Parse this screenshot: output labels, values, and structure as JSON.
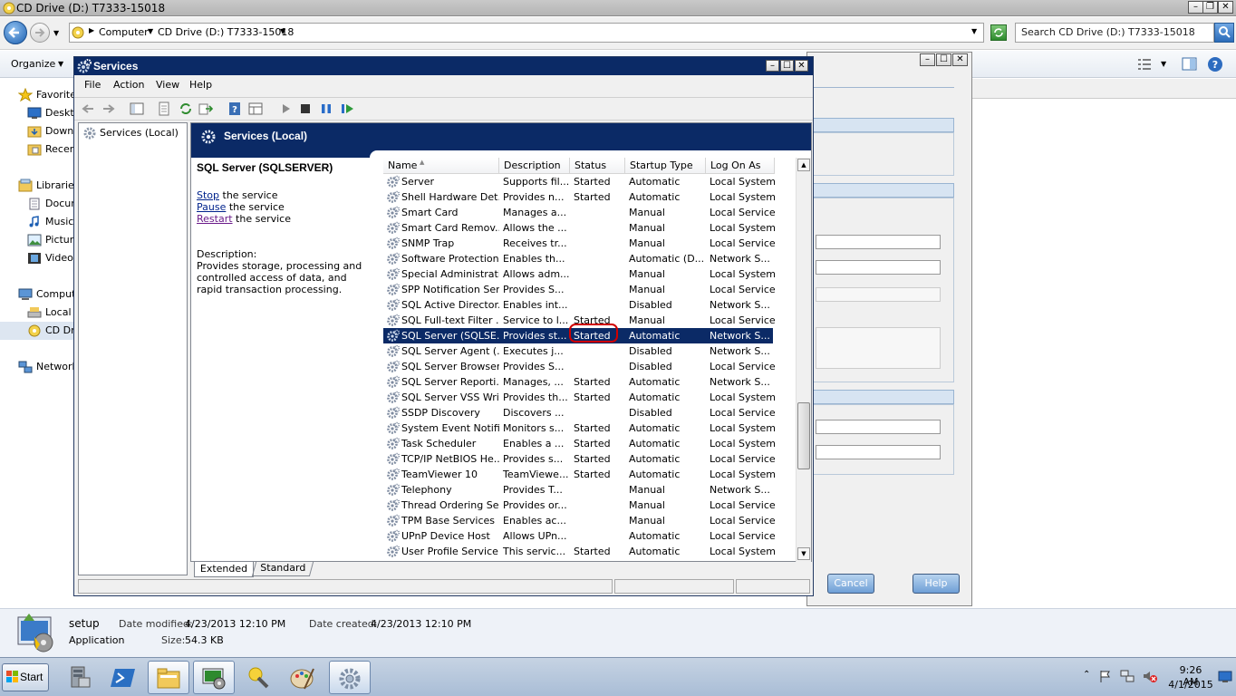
{
  "explorer": {
    "title": "CD Drive (D:) T7333-15018",
    "breadcrumb": [
      "Computer",
      "CD Drive (D:) T7333-15018"
    ],
    "search_placeholder": "Search CD Drive (D:) T7333-15018",
    "organize_label": "Organize",
    "nav_items": [
      {
        "label": "Favorites",
        "icon": "star-icon"
      },
      {
        "label": "Desktop",
        "icon": "desktop-icon"
      },
      {
        "label": "Downloads",
        "icon": "downloads-folder-icon"
      },
      {
        "label": "Recent Places",
        "icon": "recent-places-icon"
      },
      {
        "label": "Libraries",
        "icon": "library-icon"
      },
      {
        "label": "Documents",
        "icon": "documents-icon"
      },
      {
        "label": "Music",
        "icon": "music-icon"
      },
      {
        "label": "Pictures",
        "icon": "pictures-icon"
      },
      {
        "label": "Videos",
        "icon": "videos-icon"
      },
      {
        "label": "Computer",
        "icon": "computer-icon"
      },
      {
        "label": "Local Disk",
        "icon": "local-disk-icon"
      },
      {
        "label": "CD Drive",
        "icon": "cd-drive-icon"
      },
      {
        "label": "Network",
        "icon": "network-icon"
      }
    ],
    "details": {
      "name": "setup",
      "type": "Application",
      "date_modified_label": "Date modified:",
      "date_modified": "4/23/2013 12:10 PM",
      "date_created_label": "Date created:",
      "date_created": "4/23/2013 12:10 PM",
      "size_label": "Size:",
      "size": "54.3 KB"
    }
  },
  "dialog": {
    "cancel_label": "Cancel",
    "help_label": "Help"
  },
  "services_window": {
    "title": "Services",
    "menu": [
      "File",
      "Action",
      "View",
      "Help"
    ],
    "tree_item": "Services (Local)",
    "header_title": "Services (Local)",
    "selected_service": {
      "name": "SQL Server (SQLSERVER)",
      "actions": [
        {
          "link": "Stop",
          "rest": " the service"
        },
        {
          "link": "Pause",
          "rest": " the service"
        },
        {
          "link": "Restart",
          "rest": " the service"
        }
      ],
      "description_label": "Description:",
      "description": "Provides storage, processing and controlled access of data, and rapid transaction processing."
    },
    "columns": [
      "Name",
      "Description",
      "Status",
      "Startup Type",
      "Log On As"
    ],
    "rows": [
      {
        "name": "Server",
        "desc": "Supports fil...",
        "status": "Started",
        "startup": "Automatic",
        "logon": "Local System"
      },
      {
        "name": "Shell Hardware Det...",
        "desc": "Provides n...",
        "status": "Started",
        "startup": "Automatic",
        "logon": "Local System"
      },
      {
        "name": "Smart Card",
        "desc": "Manages a...",
        "status": "",
        "startup": "Manual",
        "logon": "Local Service"
      },
      {
        "name": "Smart Card Remov...",
        "desc": "Allows the ...",
        "status": "",
        "startup": "Manual",
        "logon": "Local System"
      },
      {
        "name": "SNMP Trap",
        "desc": "Receives tr...",
        "status": "",
        "startup": "Manual",
        "logon": "Local Service"
      },
      {
        "name": "Software Protection",
        "desc": "Enables th...",
        "status": "",
        "startup": "Automatic (D...",
        "logon": "Network S..."
      },
      {
        "name": "Special Administrati...",
        "desc": "Allows adm...",
        "status": "",
        "startup": "Manual",
        "logon": "Local System"
      },
      {
        "name": "SPP Notification Ser...",
        "desc": "Provides S...",
        "status": "",
        "startup": "Manual",
        "logon": "Local Service"
      },
      {
        "name": "SQL Active Director...",
        "desc": "Enables int...",
        "status": "",
        "startup": "Disabled",
        "logon": "Network S..."
      },
      {
        "name": "SQL Full-text Filter ...",
        "desc": "Service to l...",
        "status": "Started",
        "startup": "Manual",
        "logon": "Local Service"
      },
      {
        "name": "SQL Server (SQLSE...",
        "desc": "Provides st...",
        "status": "Started",
        "startup": "Automatic",
        "logon": "Network S...",
        "selected": true
      },
      {
        "name": "SQL Server Agent (...",
        "desc": "Executes j...",
        "status": "",
        "startup": "Disabled",
        "logon": "Network S..."
      },
      {
        "name": "SQL Server Browser",
        "desc": "Provides S...",
        "status": "",
        "startup": "Disabled",
        "logon": "Local Service"
      },
      {
        "name": "SQL Server Reporti...",
        "desc": "Manages, ...",
        "status": "Started",
        "startup": "Automatic",
        "logon": "Network S..."
      },
      {
        "name": "SQL Server VSS Wri...",
        "desc": "Provides th...",
        "status": "Started",
        "startup": "Automatic",
        "logon": "Local System"
      },
      {
        "name": "SSDP Discovery",
        "desc": "Discovers ...",
        "status": "",
        "startup": "Disabled",
        "logon": "Local Service"
      },
      {
        "name": "System Event Notifi...",
        "desc": "Monitors s...",
        "status": "Started",
        "startup": "Automatic",
        "logon": "Local System"
      },
      {
        "name": "Task Scheduler",
        "desc": "Enables a ...",
        "status": "Started",
        "startup": "Automatic",
        "logon": "Local System"
      },
      {
        "name": "TCP/IP NetBIOS He...",
        "desc": "Provides s...",
        "status": "Started",
        "startup": "Automatic",
        "logon": "Local Service"
      },
      {
        "name": "TeamViewer 10",
        "desc": "TeamViewe...",
        "status": "Started",
        "startup": "Automatic",
        "logon": "Local System"
      },
      {
        "name": "Telephony",
        "desc": "Provides T...",
        "status": "",
        "startup": "Manual",
        "logon": "Network S..."
      },
      {
        "name": "Thread Ordering Se...",
        "desc": "Provides or...",
        "status": "",
        "startup": "Manual",
        "logon": "Local Service"
      },
      {
        "name": "TPM Base Services",
        "desc": "Enables ac...",
        "status": "",
        "startup": "Manual",
        "logon": "Local Service"
      },
      {
        "name": "UPnP Device Host",
        "desc": "Allows UPn...",
        "status": "",
        "startup": "Automatic",
        "logon": "Local Service"
      },
      {
        "name": "User Profile Service",
        "desc": "This servic...",
        "status": "Started",
        "startup": "Automatic",
        "logon": "Local System"
      }
    ],
    "tabs": [
      "Extended",
      "Standard"
    ],
    "active_tab": "Extended",
    "colors": {
      "titlebar": "#0b2a66",
      "selection": "#0b2a66",
      "highlight_ring": "#d00000"
    }
  },
  "taskbar": {
    "start_label": "Start",
    "apps": [
      "server-manager-icon",
      "powershell-icon",
      "explorer-icon",
      "computer-management-icon",
      "tools-icon",
      "paint-icon",
      "services-icon"
    ],
    "active_app": "services-icon",
    "clock_time": "9:26 AM",
    "clock_date": "4/1/2015"
  }
}
